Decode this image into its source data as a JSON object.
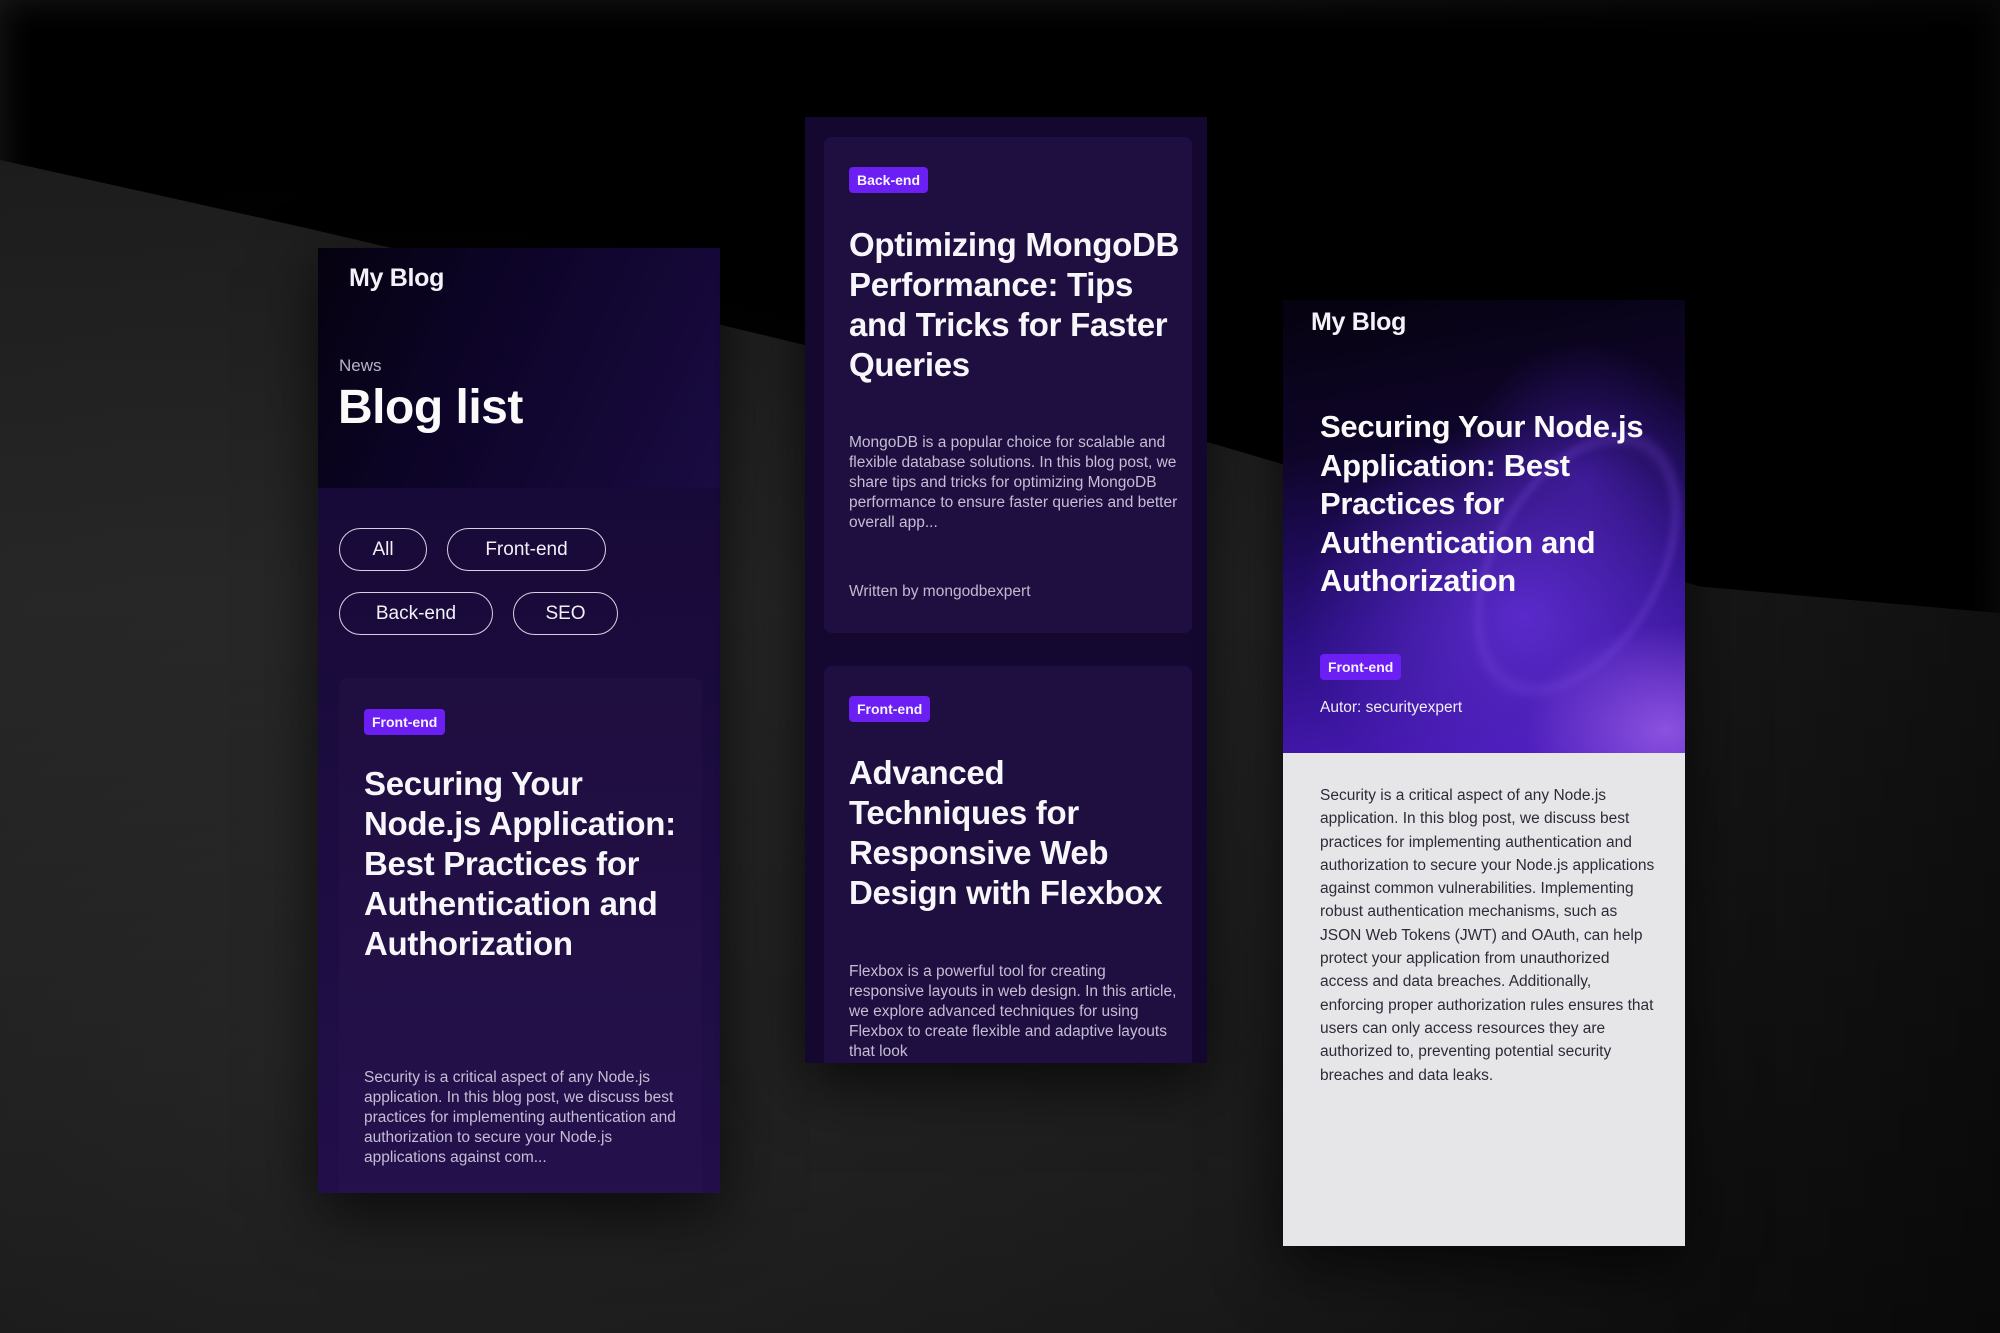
{
  "colors": {
    "badge": "#6b1ff2",
    "panel_bg": "#150830",
    "card_bg": "#1f0f40",
    "post_body_bg": "#e6e6e8"
  },
  "list_screen": {
    "brand": "My Blog",
    "kicker": "News",
    "title": "Blog list",
    "filters": [
      "All",
      "Front-end",
      "Back-end",
      "SEO"
    ],
    "card": {
      "tag": "Front-end",
      "title": "Securing Your Node.js Application: Best Practices for Authentication and Authorization",
      "excerpt": "Security is a critical aspect of any Node.js application. In this blog post, we discuss best practices for implementing authentication and authorization to secure your Node.js applications against com..."
    }
  },
  "feed_screen": {
    "cards": [
      {
        "tag": "Back-end",
        "title": "Optimizing MongoDB Performance: Tips and Tricks for Faster Queries",
        "excerpt": "MongoDB is a popular choice for scalable and flexible database solutions. In this blog post, we share tips and tricks for optimizing MongoDB performance to ensure faster queries and better overall app...",
        "author": "Written by mongodbexpert"
      },
      {
        "tag": "Front-end",
        "title": "Advanced Techniques for Responsive Web Design with Flexbox",
        "excerpt": "Flexbox is a powerful tool for creating responsive layouts in web design. In this article, we explore advanced techniques for using Flexbox to create flexible and adaptive layouts that look"
      }
    ]
  },
  "post_screen": {
    "brand": "My Blog",
    "title": "Securing Your Node.js Application: Best Practices for Authentication and Authorization",
    "tag": "Front-end",
    "author": "Autor: securityexpert",
    "body": "Security is a critical aspect of any Node.js application. In this blog post, we discuss best practices for implementing authentication and authorization to secure your Node.js applications against common vulnerabilities. Implementing robust authentication mechanisms, such as JSON Web Tokens (JWT) and OAuth, can help protect your application from unauthorized access and data breaches. Additionally, enforcing proper authorization rules ensures that users can only access resources they are authorized to, preventing potential security breaches and data leaks."
  }
}
